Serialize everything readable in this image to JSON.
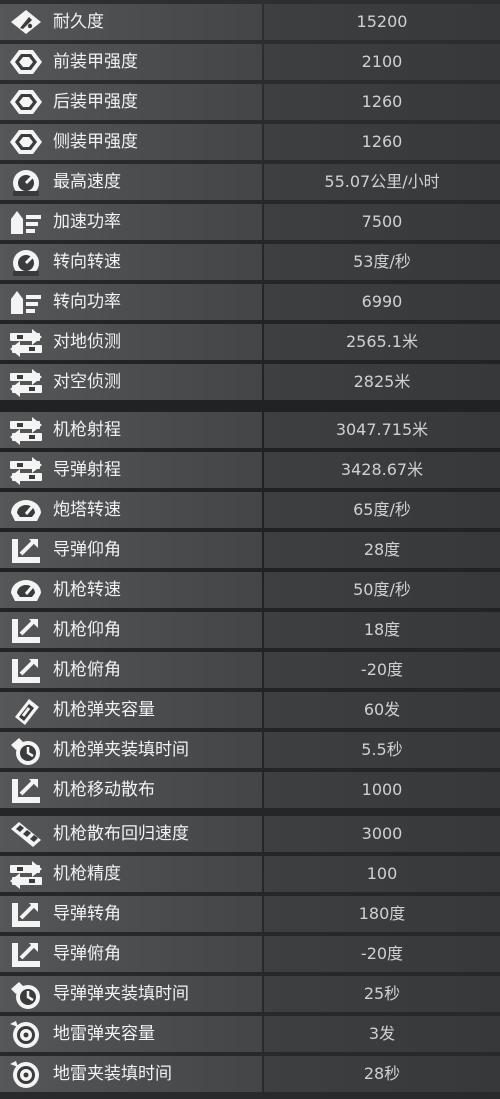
{
  "stats": [
    {
      "label": "耐久度",
      "value": "15200",
      "icon": "durability-icon"
    },
    {
      "label": "前装甲强度",
      "value": "2100",
      "icon": "armor-icon"
    },
    {
      "label": "后装甲强度",
      "value": "1260",
      "icon": "armor-icon"
    },
    {
      "label": "侧装甲强度",
      "value": "1260",
      "icon": "armor-icon"
    },
    {
      "label": "最高速度",
      "value": "55.07公里/小时",
      "icon": "speedometer-icon"
    },
    {
      "label": "加速功率",
      "value": "7500",
      "icon": "power-icon"
    },
    {
      "label": "转向转速",
      "value": "53度/秒",
      "icon": "speedometer-icon"
    },
    {
      "label": "转向功率",
      "value": "6990",
      "icon": "power-icon"
    },
    {
      "label": "对地侦测",
      "value": "2565.1米",
      "icon": "range-icon"
    },
    {
      "label": "对空侦测",
      "value": "2825米",
      "icon": "range-icon"
    },
    {
      "label": "机枪射程",
      "value": "3047.715米",
      "icon": "range-icon"
    },
    {
      "label": "导弹射程",
      "value": "3428.67米",
      "icon": "range-icon"
    },
    {
      "label": "炮塔转速",
      "value": "65度/秒",
      "icon": "turret-speed-icon"
    },
    {
      "label": "导弹仰角",
      "value": "28度",
      "icon": "angle-icon"
    },
    {
      "label": "机枪转速",
      "value": "50度/秒",
      "icon": "turret-speed-icon"
    },
    {
      "label": "机枪仰角",
      "value": "18度",
      "icon": "angle-icon"
    },
    {
      "label": "机枪俯角",
      "value": "-20度",
      "icon": "angle-icon"
    },
    {
      "label": "机枪弹夹容量",
      "value": "60发",
      "icon": "ammo-icon"
    },
    {
      "label": "机枪弹夹装填时间",
      "value": "5.5秒",
      "icon": "reload-timer-icon"
    },
    {
      "label": "机枪移动散布",
      "value": "1000",
      "icon": "angle-icon"
    },
    {
      "label": "机枪散布回归速度",
      "value": "3000",
      "icon": "ammo-stack-icon"
    },
    {
      "label": "机枪精度",
      "value": "100",
      "icon": "range-icon"
    },
    {
      "label": "导弹转角",
      "value": "180度",
      "icon": "angle-icon"
    },
    {
      "label": "导弹俯角",
      "value": "-20度",
      "icon": "angle-icon"
    },
    {
      "label": "导弹弹夹装填时间",
      "value": "25秒",
      "icon": "reload-timer-icon"
    },
    {
      "label": "地雷弹夹容量",
      "value": "3发",
      "icon": "mine-icon"
    },
    {
      "label": "地雷夹装填时间",
      "value": "28秒",
      "icon": "mine-icon"
    }
  ]
}
